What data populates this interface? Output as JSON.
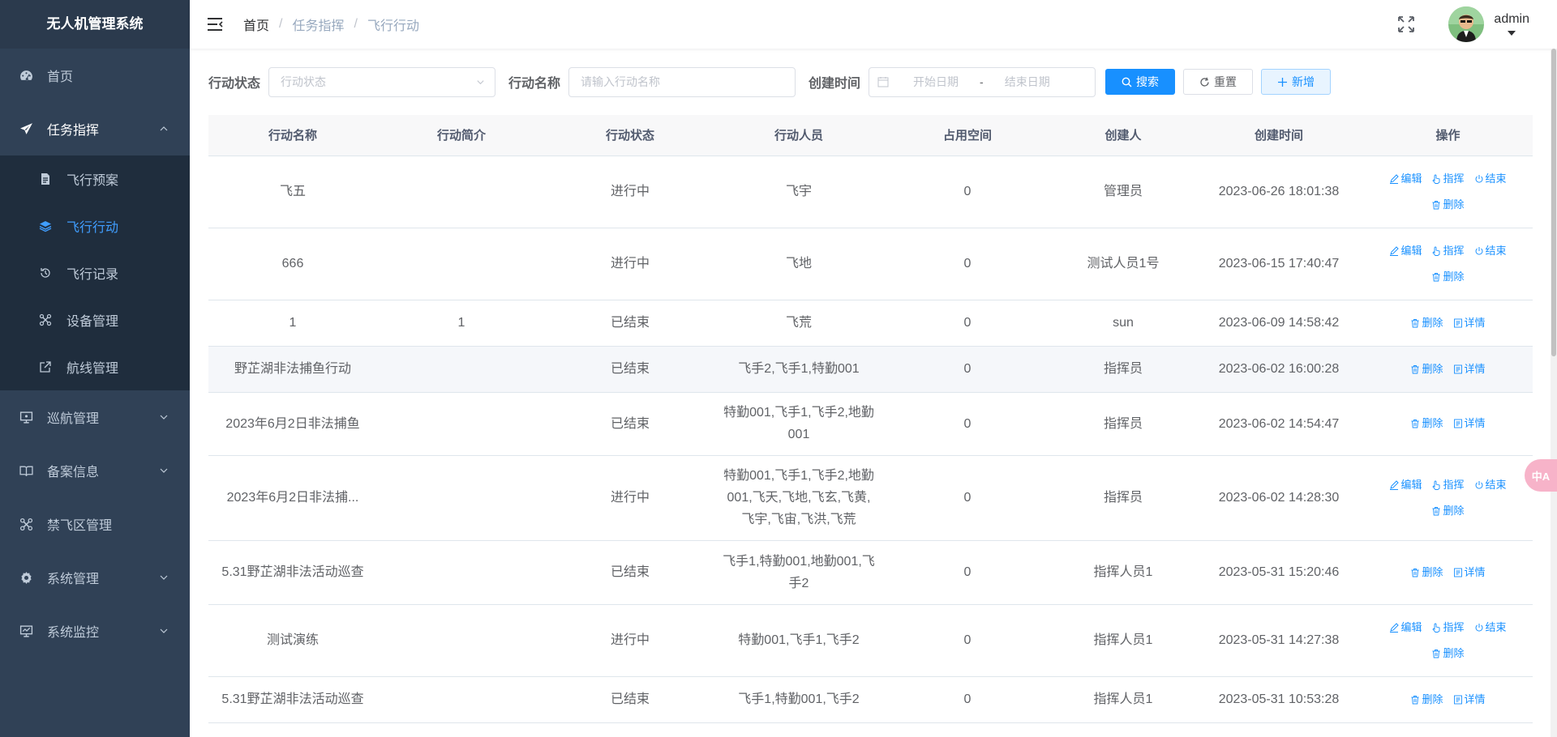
{
  "app": {
    "title": "无人机管理系统"
  },
  "sidebar": {
    "home": "首页",
    "task": {
      "label": "任务指挥",
      "items": [
        "飞行预案",
        "飞行行动",
        "飞行记录",
        "设备管理",
        "航线管理"
      ]
    },
    "cruise": "巡航管理",
    "record": "备案信息",
    "nofly": "禁飞区管理",
    "system": "系统管理",
    "monitor": "系统监控"
  },
  "breadcrumb": [
    "首页",
    "任务指挥",
    "飞行行动"
  ],
  "user": {
    "name": "admin"
  },
  "float": {
    "label": "中A"
  },
  "search": {
    "status_label": "行动状态",
    "status_placeholder": "行动状态",
    "name_label": "行动名称",
    "name_placeholder": "请输入行动名称",
    "time_label": "创建时间",
    "start_placeholder": "开始日期",
    "range_sep": "-",
    "end_placeholder": "结束日期",
    "search_btn": "搜索",
    "reset_btn": "重置",
    "add_btn": "新增"
  },
  "table": {
    "columns": [
      "行动名称",
      "行动简介",
      "行动状态",
      "行动人员",
      "占用空间",
      "创建人",
      "创建时间",
      "操作"
    ],
    "ops": {
      "edit": "编辑",
      "command": "指挥",
      "end": "结束",
      "delete": "删除",
      "detail": "详情"
    },
    "rows": [
      {
        "name": "飞五",
        "intro": "",
        "status": "进行中",
        "people": "飞宇",
        "space": "0",
        "creator": "管理员",
        "time": "2023-06-26 18:01:38"
      },
      {
        "name": "666",
        "intro": "",
        "status": "进行中",
        "people": "飞地",
        "space": "0",
        "creator": "测试人员1号",
        "time": "2023-06-15 17:40:47"
      },
      {
        "name": "1",
        "intro": "1",
        "status": "已结束",
        "people": "飞荒",
        "space": "0",
        "creator": "sun",
        "time": "2023-06-09 14:58:42"
      },
      {
        "name": "野芷湖非法捕鱼行动",
        "intro": "",
        "status": "已结束",
        "people": "飞手2,飞手1,特勤001",
        "space": "0",
        "creator": "指挥员",
        "time": "2023-06-02 16:00:28"
      },
      {
        "name": "2023年6月2日非法捕鱼",
        "intro": "",
        "status": "已结束",
        "people": "特勤001,飞手1,飞手2,地勤001",
        "space": "0",
        "creator": "指挥员",
        "time": "2023-06-02 14:54:47"
      },
      {
        "name": "2023年6月2日非法捕...",
        "intro": "",
        "status": "进行中",
        "people": "特勤001,飞手1,飞手2,地勤001,飞天,飞地,飞玄,飞黄,飞宇,飞宙,飞洪,飞荒",
        "space": "0",
        "creator": "指挥员",
        "time": "2023-06-02 14:28:30"
      },
      {
        "name": "5.31野芷湖非法活动巡查",
        "intro": "",
        "status": "已结束",
        "people": "飞手1,特勤001,地勤001,飞手2",
        "space": "0",
        "creator": "指挥人员1",
        "time": "2023-05-31 15:20:46"
      },
      {
        "name": "测试演练",
        "intro": "",
        "status": "进行中",
        "people": "特勤001,飞手1,飞手2",
        "space": "0",
        "creator": "指挥人员1",
        "time": "2023-05-31 14:27:38"
      },
      {
        "name": "5.31野芷湖非法活动巡查",
        "intro": "",
        "status": "已结束",
        "people": "飞手1,特勤001,飞手2",
        "space": "0",
        "creator": "指挥人员1",
        "time": "2023-05-31 10:53:28"
      }
    ]
  }
}
